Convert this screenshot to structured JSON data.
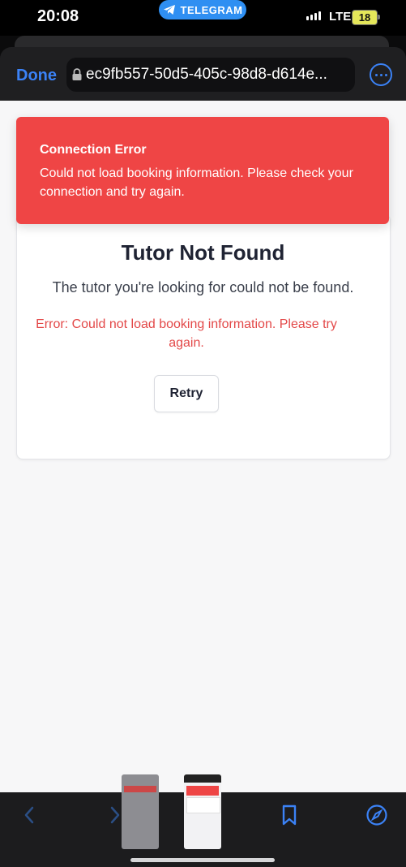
{
  "status_bar": {
    "time": "20:08",
    "telegram_pill": "TELEGRAM",
    "network": "LTE",
    "battery": "18"
  },
  "browser": {
    "done_label": "Done",
    "url": "ec9fb557-50d5-405c-98d8-d614e...",
    "accent_color": "#3b82f6"
  },
  "alert": {
    "title": "Connection Error",
    "message": "Could not load booking information. Please check your connection and try again.",
    "color": "#ef4545"
  },
  "card": {
    "title": "Tutor Not Found",
    "message": "The tutor you're looking for could not be found.",
    "error": "Error: Could not load booking information. Please try again.",
    "retry_label": "Retry"
  },
  "toolbar": {
    "icons": [
      "back-icon",
      "forward-icon",
      "bookmarks-icon",
      "compass-icon"
    ]
  }
}
